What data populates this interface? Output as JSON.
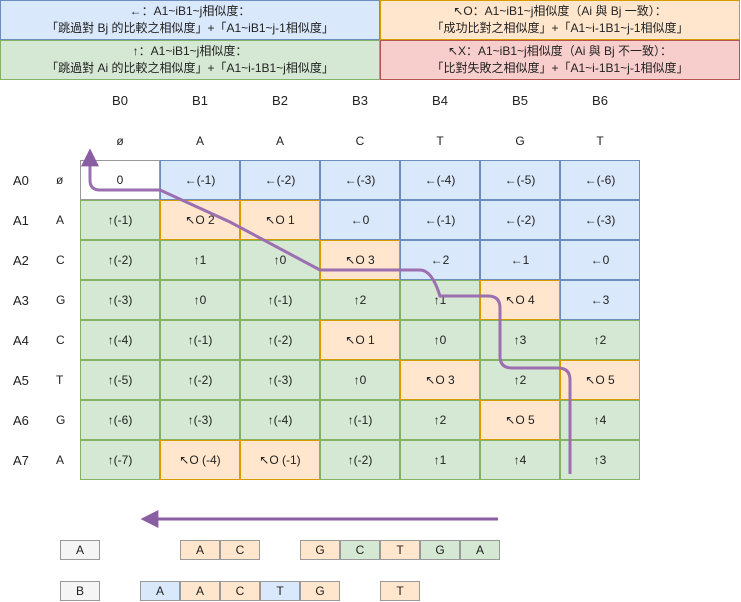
{
  "legend": {
    "left": {
      "l1": "←：A1~iB1~j相似度：",
      "l2": "「跳過對 Bj 的比較之相似度」+「A1~iB1~j-1相似度」"
    },
    "up": {
      "l1": "↑：A1~iB1~j相似度：",
      "l2": "「跳過對 Ai 的比較之相似度」+「A1~i-1B1~j相似度」"
    },
    "match": {
      "l1": "↖O：A1~iB1~j相似度（Ai 與 Bj 一致）：",
      "l2": "「成功比對之相似度」+「A1~i-1B1~j-1相似度」"
    },
    "mismatch": {
      "l1": "↖X：A1~iB1~j相似度（Ai 與 Bj 不一致）：",
      "l2": "「比對失敗之相似度」+「A1~i-1B1~j-1相似度」"
    }
  },
  "col_labels": [
    "B0",
    "B1",
    "B2",
    "B3",
    "B4",
    "B5",
    "B6"
  ],
  "col_chars": [
    "ø",
    "A",
    "A",
    "C",
    "T",
    "G",
    "T"
  ],
  "row_labels": [
    "A0",
    "A1",
    "A2",
    "A3",
    "A4",
    "A5",
    "A6",
    "A7"
  ],
  "row_chars": [
    "ø",
    "A",
    "C",
    "G",
    "C",
    "T",
    "G",
    "A"
  ],
  "matrix": [
    [
      {
        "t": "0",
        "c": "w"
      },
      {
        "t": "←(-1)",
        "c": "b"
      },
      {
        "t": "←(-2)",
        "c": "b"
      },
      {
        "t": "←(-3)",
        "c": "b"
      },
      {
        "t": "←(-4)",
        "c": "b"
      },
      {
        "t": "←(-5)",
        "c": "b"
      },
      {
        "t": "←(-6)",
        "c": "b"
      }
    ],
    [
      {
        "t": "↑(-1)",
        "c": "g"
      },
      {
        "t": "↖O 2",
        "c": "o"
      },
      {
        "t": "↖O 1",
        "c": "o"
      },
      {
        "t": "←0",
        "c": "b"
      },
      {
        "t": "←(-1)",
        "c": "b"
      },
      {
        "t": "←(-2)",
        "c": "b"
      },
      {
        "t": "←(-3)",
        "c": "b"
      }
    ],
    [
      {
        "t": "↑(-2)",
        "c": "g"
      },
      {
        "t": "↑1",
        "c": "g"
      },
      {
        "t": "↑0",
        "c": "g"
      },
      {
        "t": "↖O 3",
        "c": "o"
      },
      {
        "t": "←2",
        "c": "b"
      },
      {
        "t": "←1",
        "c": "b"
      },
      {
        "t": "←0",
        "c": "b"
      }
    ],
    [
      {
        "t": "↑(-3)",
        "c": "g"
      },
      {
        "t": "↑0",
        "c": "g"
      },
      {
        "t": "↑(-1)",
        "c": "g"
      },
      {
        "t": "↑2",
        "c": "g"
      },
      {
        "t": "↑1",
        "c": "g"
      },
      {
        "t": "↖O 4",
        "c": "o"
      },
      {
        "t": "←3",
        "c": "b"
      }
    ],
    [
      {
        "t": "↑(-4)",
        "c": "g"
      },
      {
        "t": "↑(-1)",
        "c": "g"
      },
      {
        "t": "↑(-2)",
        "c": "g"
      },
      {
        "t": "↖O 1",
        "c": "o"
      },
      {
        "t": "↑0",
        "c": "g"
      },
      {
        "t": "↑3",
        "c": "g"
      },
      {
        "t": "↑2",
        "c": "g"
      }
    ],
    [
      {
        "t": "↑(-5)",
        "c": "g"
      },
      {
        "t": "↑(-2)",
        "c": "g"
      },
      {
        "t": "↑(-3)",
        "c": "g"
      },
      {
        "t": "↑0",
        "c": "g"
      },
      {
        "t": "↖O 3",
        "c": "o"
      },
      {
        "t": "↑2",
        "c": "g"
      },
      {
        "t": "↖O 5",
        "c": "o"
      }
    ],
    [
      {
        "t": "↑(-6)",
        "c": "g"
      },
      {
        "t": "↑(-3)",
        "c": "g"
      },
      {
        "t": "↑(-4)",
        "c": "g"
      },
      {
        "t": "↑(-1)",
        "c": "g"
      },
      {
        "t": "↑2",
        "c": "g"
      },
      {
        "t": "↖O 5",
        "c": "o"
      },
      {
        "t": "↑4",
        "c": "g"
      }
    ],
    [
      {
        "t": "↑(-7)",
        "c": "g"
      },
      {
        "t": "↖O (-4)",
        "c": "o"
      },
      {
        "t": "↖O (-1)",
        "c": "o"
      },
      {
        "t": "↑(-2)",
        "c": "g"
      },
      {
        "t": "↑1",
        "c": "g"
      },
      {
        "t": "↑4",
        "c": "g"
      },
      {
        "t": "↑3",
        "c": "g"
      }
    ]
  ],
  "alignment": {
    "a_label": "A",
    "b_label": "B",
    "a_cells": [
      {
        "t": "A",
        "c": "o"
      },
      {
        "t": "C",
        "c": "o"
      },
      {
        "t": "G",
        "c": "o"
      },
      {
        "t": "C",
        "c": "g"
      },
      {
        "t": "T",
        "c": "o"
      },
      {
        "t": "G",
        "c": "g"
      },
      {
        "t": "A",
        "c": "g"
      }
    ],
    "b_cells": [
      {
        "t": "A",
        "c": "b"
      },
      {
        "t": "A",
        "c": "o"
      },
      {
        "t": "C",
        "c": "o"
      },
      {
        "t": "T",
        "c": "b"
      },
      {
        "t": "G",
        "c": "o"
      },
      {
        "t": "T",
        "c": "o"
      }
    ]
  },
  "colors": {
    "path": "#9b6fb0",
    "arrow": "#8a5ea3"
  }
}
